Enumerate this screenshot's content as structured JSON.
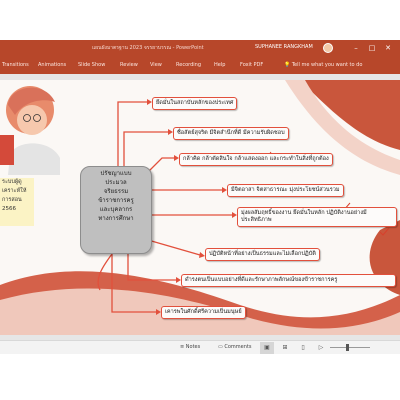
{
  "titlebar": {
    "title": "แผนผังมาตรฐาน 2023 จรรยาบรรณ - PowerPoint",
    "user": "SUPHANEE RANGKHAM",
    "buttons": [
      "–",
      "□",
      "✕"
    ]
  },
  "ribbon": {
    "tabs": [
      "Transitions",
      "Animations",
      "Slide Show",
      "Review",
      "View",
      "Recording",
      "Help",
      "Foxit PDF"
    ],
    "tell_me": "Tell me what you want to do"
  },
  "slide": {
    "center": [
      "ปรัชญาแบบ",
      "ประมวล",
      "จริยธรรม",
      "ข้าราชการครู",
      "และบุคลากร",
      "ทางการศึกษา"
    ],
    "left_card": [
      "ระบบผู้ดู",
      "เคราะห์ให้",
      "การสอน",
      "2566"
    ],
    "nodes": [
      "ยึดมั่นในสถาบันหลักของประเทศ",
      "ซื่อสัตย์สุจริต มีจิตสำนึกที่ดี มีความรับผิดชอบ",
      "กล้าคิด กล้าตัดสินใจ กล้าแสดงออก และกระทำในสิ่งที่ถูกต้อง",
      "มีจิตอาสา จิตสาธารณะ มุ่งประโยชน์ส่วนรวม",
      "มุ่งผลสัมฤทธิ์ของงาน ยึดมั่นในหลัก ปฏิบัติงานอย่างมีประสิทธิภาพ",
      "ปฏิบัติหน้าที่อย่างเป็นธรรมและไม่เลือกปฏิบัติ",
      "ดำรงตนเป็นแบบอย่างที่ดีและรักษาภาพลักษณ์ของข้าราชการครู",
      "เคารพในศักดิ์ศรีความเป็นมนุษย์"
    ]
  },
  "statusbar": {
    "notes": "Notes",
    "comments": "Comments"
  },
  "colors": {
    "brand": "#b7472a",
    "node_border": "#e2503c",
    "connector": "#e2503c",
    "center_fill": "#bfbfbf"
  },
  "icons": [
    "window-minimize-icon",
    "window-maximize-icon",
    "window-close-icon",
    "lightbulb-icon",
    "notes-icon",
    "comments-icon",
    "normal-view-icon",
    "slide-sorter-icon",
    "reading-view-icon",
    "slideshow-icon"
  ]
}
